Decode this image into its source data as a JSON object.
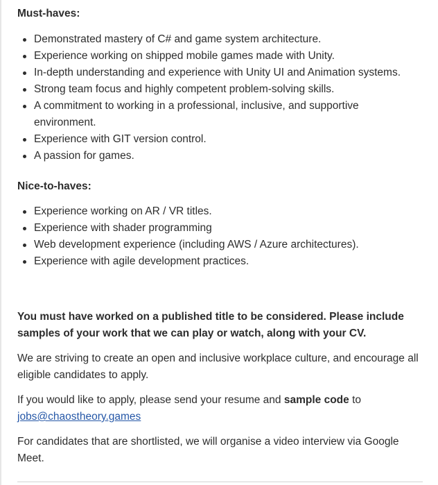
{
  "must_haves": {
    "heading": "Must-haves:",
    "items": [
      "Demonstrated mastery of C# and game system architecture.",
      "Experience working on shipped mobile games made with Unity.",
      "In-depth understanding and experience with Unity UI and Animation systems.",
      "Strong team focus and highly competent problem-solving skills.",
      "A commitment to working in a professional, inclusive, and supportive environment.",
      "Experience with GIT version control.",
      "A passion for games."
    ]
  },
  "nice_to_haves": {
    "heading": "Nice-to-haves:",
    "items": [
      "Experience working on AR / VR titles.",
      "Experience with shader programming",
      "Web development experience (including AWS / Azure architectures).",
      "Experience with agile development practices."
    ]
  },
  "notice": "You must have worked on a published title to be considered. Please include samples of your work that we can play or watch, along with your CV.",
  "culture_text": "We are striving to create an open and inclusive workplace culture, and encourage all eligible candidates to apply.",
  "apply": {
    "before": "If you would like to apply, please send your resume and ",
    "bold": "sample code",
    "after": " to",
    "email": "jobs@chaostheory.games"
  },
  "interview_text": "For candidates that are shortlisted, we will organise a video interview via Google Meet."
}
